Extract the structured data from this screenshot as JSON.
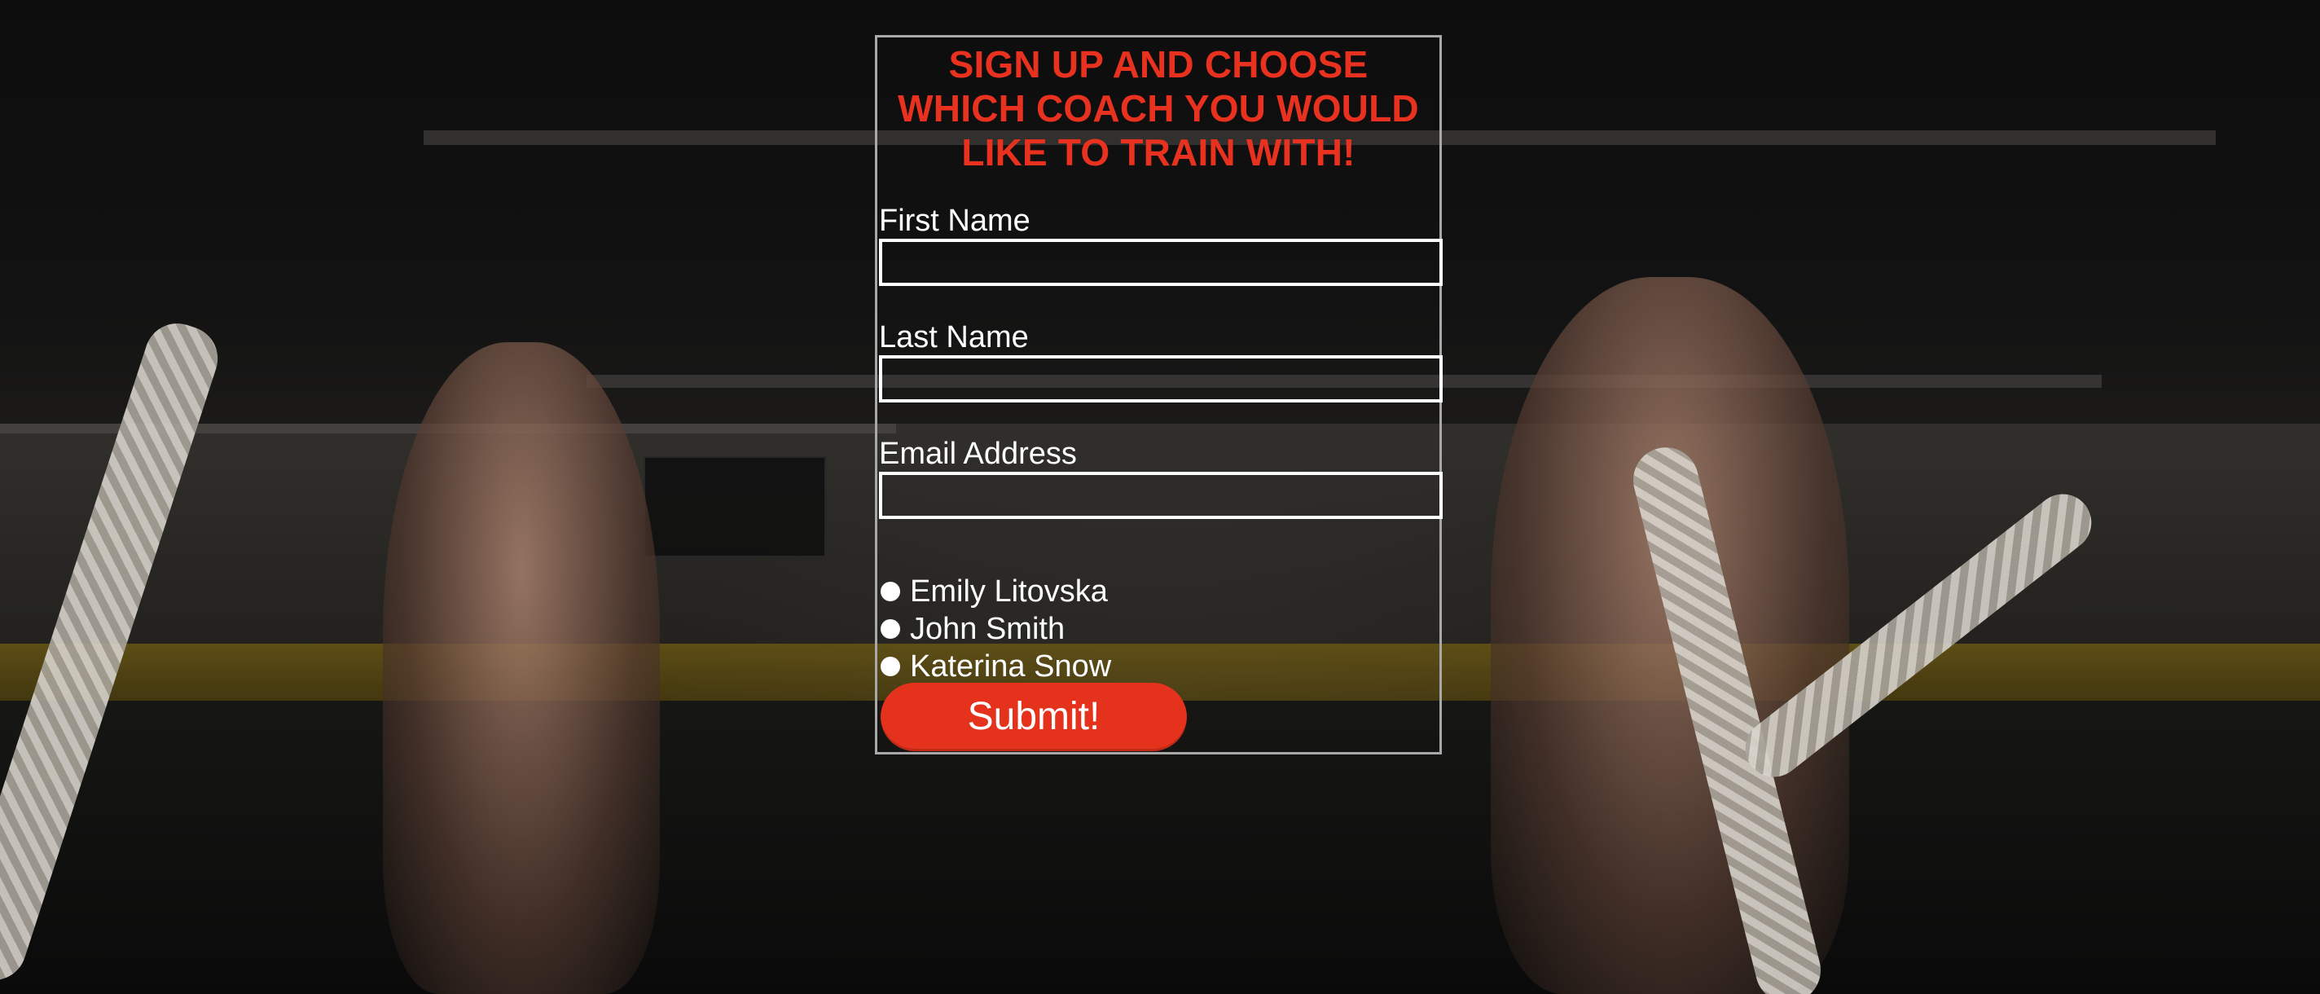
{
  "form": {
    "title": "SIGN UP AND CHOOSE WHICH COACH YOU WOULD LIKE TO TRAIN WITH!",
    "fields": [
      {
        "label": "First Name",
        "value": "",
        "placeholder": ""
      },
      {
        "label": "Last Name",
        "value": "",
        "placeholder": ""
      },
      {
        "label": "Email Address",
        "value": "",
        "placeholder": ""
      }
    ],
    "coaches": [
      {
        "label": "Emily Litovska",
        "selected": false
      },
      {
        "label": "John Smith",
        "selected": false
      },
      {
        "label": "Katerina Snow",
        "selected": false
      }
    ],
    "submit_label": "Submit!"
  },
  "colors": {
    "accent": "#e8321f",
    "text": "#ffffff",
    "panel_border": "#a8a8a8"
  }
}
